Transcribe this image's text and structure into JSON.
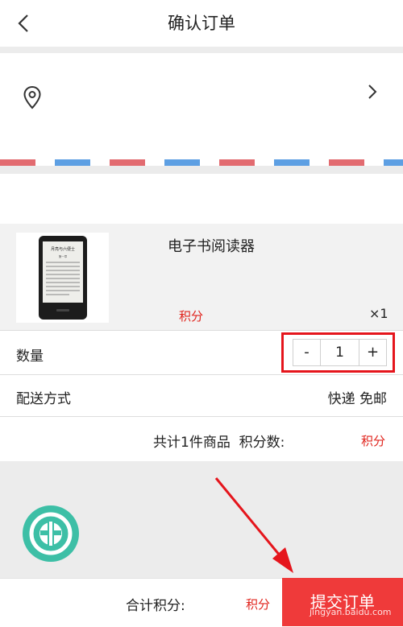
{
  "header": {
    "title": "确认订单"
  },
  "product": {
    "name": "电子书阅读器",
    "points_label": "积分",
    "count": "×1",
    "screen_title": "月亮与六便士",
    "screen_chapter": "第一章"
  },
  "quantity": {
    "label": "数量",
    "minus": "-",
    "value": "1",
    "plus": "+"
  },
  "shipping": {
    "label": "配送方式",
    "value": "快递 免邮"
  },
  "summary": {
    "text": "共计1件商品  积分数:",
    "points_label": "积分"
  },
  "bottom": {
    "total_label": "合计积分:",
    "total_points": "积分",
    "submit_label": "提交订单"
  },
  "watermark": "jingyan.baidu.com",
  "colors": {
    "accent": "#e0231c",
    "submit_bg": "#ef3a3a",
    "logo": "#3dbfa6",
    "stripe_red": "#e26b70",
    "stripe_blue": "#5d9fe3"
  }
}
